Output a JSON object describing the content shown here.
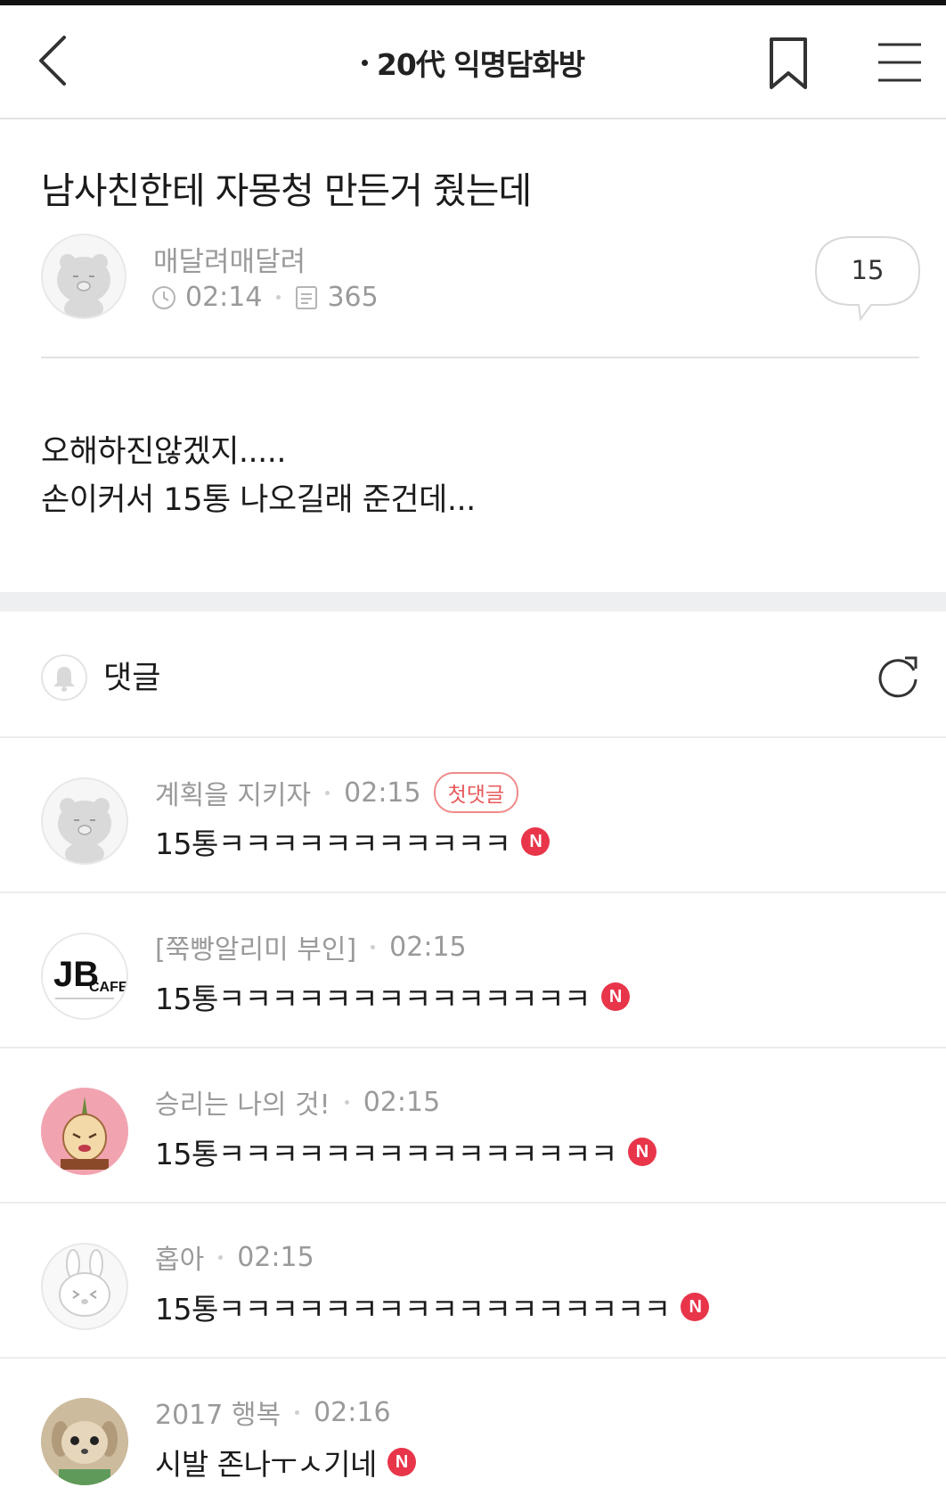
{
  "header": {
    "title": "20代 익명담화방",
    "back_icon": "chevron-left-icon",
    "bookmark_icon": "bookmark-icon",
    "menu_icon": "hamburger-menu-icon"
  },
  "post": {
    "title": "남사친한테 자몽청 만든거 줬는데",
    "author": "매달려매달려",
    "time": "02:14",
    "views": "365",
    "comment_count": "15",
    "body_lines": [
      "오해하진않겠지.....",
      "손이커서 15통 나오길래 준건데..."
    ]
  },
  "comments_section": {
    "label": "댓글",
    "bell_icon": "bell-icon",
    "refresh_icon": "refresh-icon"
  },
  "comments": [
    {
      "author": "계획을 지키자",
      "time": "02:15",
      "badge": "첫댓글",
      "text": "15통ㅋㅋㅋㅋㅋㅋㅋㅋㅋㅋㅋ",
      "new_label": "N"
    },
    {
      "author": "[쭉빵알리미 부인]",
      "time": "02:15",
      "text": "15통ㅋㅋㅋㅋㅋㅋㅋㅋㅋㅋㅋㅋㅋㅋ",
      "new_label": "N"
    },
    {
      "author": "승리는 나의 것!",
      "time": "02:15",
      "text": "15통ㅋㅋㅋㅋㅋㅋㅋㅋㅋㅋㅋㅋㅋㅋㅋ",
      "new_label": "N"
    },
    {
      "author": "홉아",
      "time": "02:15",
      "text": "15통ㅋㅋㅋㅋㅋㅋㅋㅋㅋㅋㅋㅋㅋㅋㅋㅋㅋ",
      "new_label": "N"
    },
    {
      "author": "2017 행복",
      "time": "02:16",
      "text": "시발 존나ㅜㅅ기네",
      "new_label": "N"
    }
  ],
  "colors": {
    "new_badge": "#e8354a",
    "first_badge_border": "#f08a8a",
    "meta_text": "#9a9a9a",
    "section_gap": "#eeeff1"
  }
}
